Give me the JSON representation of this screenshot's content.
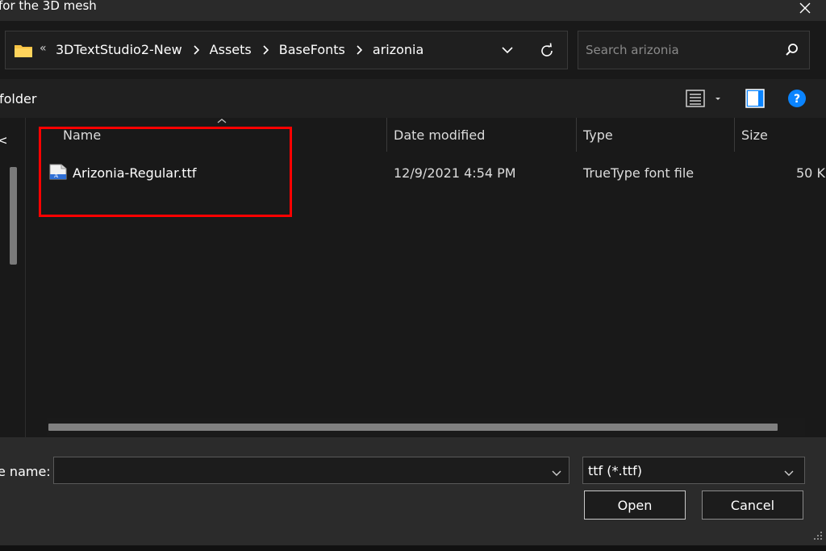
{
  "window": {
    "title": "for the 3D mesh",
    "close_icon": "close-icon"
  },
  "address": {
    "overflow_label": "«",
    "breadcrumbs": [
      "3DTextStudio2-New",
      "Assets",
      "BaseFonts",
      "arizonia"
    ],
    "folder_icon": "folder-icon",
    "history_icon": "chevron-down-icon",
    "refresh_icon": "refresh-icon"
  },
  "search": {
    "placeholder": "Search arizonia",
    "icon": "search-icon"
  },
  "commandbar": {
    "new_folder_label": "folder",
    "view_icon": "view-list-icon",
    "preview_icon": "preview-pane-icon",
    "help_label": "?"
  },
  "navpane": {
    "cut_text": "<"
  },
  "columns": {
    "name": "Name",
    "date": "Date modified",
    "type": "Type",
    "size": "Size"
  },
  "files": [
    {
      "name": "Arizonia-Regular.ttf",
      "date": "12/9/2021 4:54 PM",
      "type": "TrueType font file",
      "size": "50 K",
      "icon": "font-file-icon"
    }
  ],
  "footer": {
    "filename_label": "e name:",
    "filename_value": "",
    "filetype_value": "ttf (*.ttf)",
    "open_label": "Open",
    "cancel_label": "Cancel"
  },
  "colors": {
    "highlight": "#ff0000",
    "accent_blue": "#0a84ff",
    "folder_yellow": "#f6c244"
  }
}
